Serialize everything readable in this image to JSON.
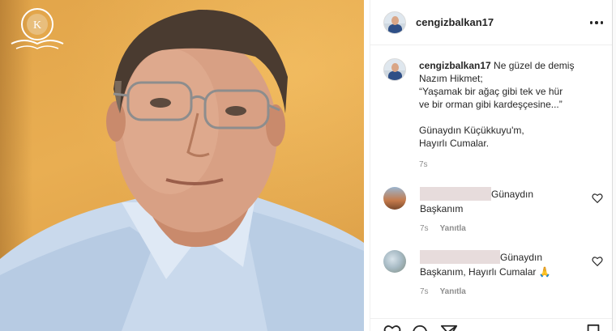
{
  "post": {
    "username": "cengizbalkan17",
    "more_icon": "more-horizontal-icon"
  },
  "caption": {
    "username": "cengizbalkan17",
    "lines": [
      " Ne güzel de demiş",
      "Nazım Hikmet;",
      "“Yaşamak bir ağaç gibi tek ve hür",
      "ve bir orman gibi kardeşçesine...”"
    ],
    "lines2": [
      "Günaydın Küçükkuyu'm,",
      "Hayırlı Cumalar."
    ],
    "time": "7s"
  },
  "comments": [
    {
      "text_first": "Günaydın",
      "text_rest": "Başkanım",
      "time": "7s",
      "reply": "Yanıtla"
    },
    {
      "text_first": "Günaydın",
      "text_rest": "Başkanım, Hayırlı Cumalar 🙏",
      "time": "7s",
      "reply": "Yanıtla"
    }
  ],
  "colors": {
    "accent_text": "#262626",
    "meta_text": "#8e8e8e",
    "border": "#efefef",
    "wall": "#e2a54a"
  }
}
